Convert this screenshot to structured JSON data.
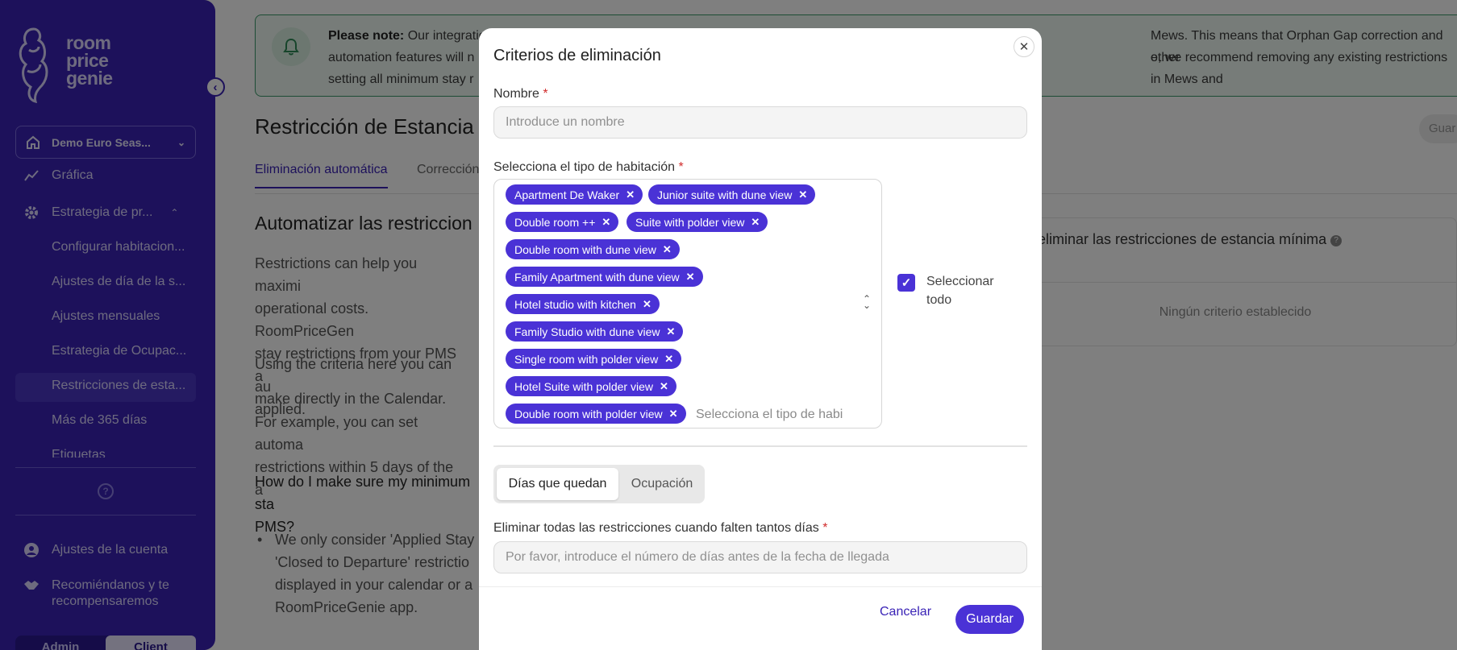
{
  "sidebar": {
    "logo_lines": [
      "room",
      "price",
      "genie"
    ],
    "hotel_name": "Demo Euro Seas...",
    "nav": {
      "grafica": "Gráfica",
      "estrategia": "Estrategia de pr...",
      "sub_items": [
        "Configurar habitacion...",
        "Ajustes de día de la s...",
        "Ajustes mensuales",
        "Estrategia de Ocupac...",
        "Restricciones de esta...",
        "Más de 365 días",
        "Etiquetas"
      ],
      "account": "Ajustes de la cuenta",
      "refer_line1": "Recomiéndanos y te",
      "refer_line2": "recompensaremos"
    },
    "toggle": [
      "Admin",
      "Client"
    ]
  },
  "banner": {
    "bold": "Please note:",
    "line1": " Our integratio",
    "line1_right": "Mews. This means that Orphan Gap correction and other",
    "line2": "automation features will n",
    "line2_right": "e, we recommend removing any existing restrictions in Mews and",
    "line3": "setting all minimum stay r"
  },
  "page": {
    "title": "Restricción de Estancia",
    "tab_active": "Eliminación automática",
    "tab_other": "Corrección",
    "save_top": "Guar",
    "section_title": "Automatizar las restriccion",
    "para1": [
      "Restrictions can help you maximi",
      "operational costs. RoomPriceGen",
      "stay restrictions from your PMS a",
      "make directly in the Calendar."
    ],
    "para2": [
      "Using the criteria here you can au",
      "applied."
    ],
    "para3": [
      "For example, you can set automa",
      "restrictions within 5 days of the a"
    ],
    "faq_q": [
      "How do I make sure my minimum sta",
      "PMS?"
    ],
    "bullet": [
      "We only consider 'Applied Stay",
      "'Closed to Departure' restrictio",
      "displayed in your calendar or a",
      "RoomPriceGenie app."
    ],
    "right_card_title": "eliminar las restricciones de estancia mínima",
    "right_card_empty": "Ningún criterio establecido"
  },
  "modal": {
    "title": "Criterios de eliminación",
    "name_label": "Nombre",
    "name_placeholder": "Introduce un nombre",
    "room_label": "Selecciona el tipo de habitación",
    "room_chips": [
      "Apartment De Waker",
      "Junior suite with dune view",
      "Double room ++",
      "Suite with polder view",
      "Double room with dune view",
      "Family Apartment with dune view",
      "Hotel studio with kitchen",
      "Family Studio with dune view",
      "Single room with polder view",
      "Hotel Suite with polder view",
      "Double room with polder view"
    ],
    "room_placeholder": "Selecciona el tipo de habi",
    "select_all": "Seleccionar todo",
    "seg_days": "Días que quedan",
    "seg_occupancy": "Ocupación",
    "days_label": "Eliminar todas las restricciones cuando falten tantos días",
    "days_placeholder": "Por favor, introduce el número de días antes de la fecha de llegada",
    "required_mark": "*",
    "cancel": "Cancelar",
    "save": "Guardar"
  },
  "colors": {
    "sidebar": "#3a23b6",
    "accent": "#4a32d6",
    "banner_border": "#3b9b6b",
    "required": "#d12c2c"
  }
}
